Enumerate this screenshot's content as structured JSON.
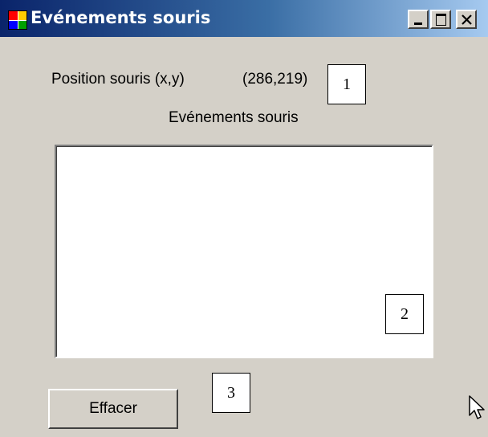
{
  "window": {
    "title": "Evénements souris",
    "icon": "windows-form-icon",
    "controls": {
      "minimize_icon": "minimize-icon",
      "maximize_icon": "maximize-icon",
      "close_icon": "close-icon"
    }
  },
  "form": {
    "position_label": "Position souris (x,y)",
    "position_value": "(286,219)",
    "events_label": "Evénements souris",
    "events_list": [],
    "clear_button_label": "Effacer"
  },
  "annotations": {
    "callout_1": "1",
    "callout_2": "2",
    "callout_3": "3"
  },
  "colors": {
    "face": "#d4d0c8",
    "title_gradient_start": "#0a246a",
    "title_gradient_end": "#a6caf0",
    "title_text": "#ffffff"
  }
}
